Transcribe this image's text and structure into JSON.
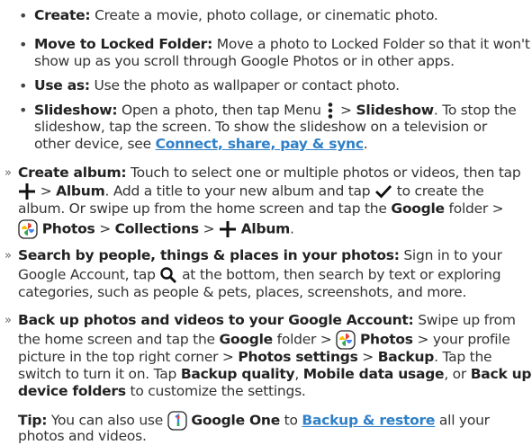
{
  "items": {
    "create": {
      "label": "Create:",
      "text": "Create a movie, photo collage, or cinematic photo."
    },
    "locked": {
      "label": "Move to Locked Folder:",
      "line1": "Move a photo to Locked Folder so that it won't",
      "line2": "show up as you scroll through Google Photos or in other apps."
    },
    "useas": {
      "label": "Use as:",
      "text": "Use the photo as wallpaper or contact photo."
    },
    "slideshow": {
      "label": "Slideshow:",
      "pre": "Open a photo, then tap Menu",
      "sep": ">",
      "target": "Slideshow",
      "post": ". To stop the",
      "line2": "slideshow, tap the screen. To show the slideshow on a television or",
      "line3": "other device, see",
      "link": "Connect, share, pay & sync",
      "end": "."
    }
  },
  "sections": {
    "album": {
      "label": "Create album:",
      "line1": "Touch to select one or multiple photos or videos, then tap",
      "sep": ">",
      "album": "Album",
      "mid": ". Add a title to your new album and tap",
      "mid2": "to create the",
      "line3": "album. Or swipe up from the home screen and tap the",
      "google": "Google",
      "folder": "folder >",
      "photos": "Photos",
      "collections": "Collections",
      "album2": "Album",
      "end": "."
    },
    "search": {
      "label": "Search by people, things & places in your photos:",
      "pre": "Sign in to your",
      "line2a": "Google Account, tap",
      "line2b": "at the bottom, then search by text or exploring",
      "line3": "categories, such as people & pets, places, screenshots, and more."
    },
    "backup": {
      "label": "Back up photos and videos to your Google Account:",
      "pre": "Swipe up from",
      "line2a": "the home screen and tap the",
      "google": "Google",
      "line2b": "folder >",
      "photos": "Photos",
      "line2c": "> your profile",
      "line3a": "picture in the top right corner >",
      "settings": "Photos settings",
      "sep": ">",
      "backup": "Backup",
      "line3b": ". Tap the",
      "line4a": "switch to turn it on. Tap",
      "quality": "Backup quality",
      "comma": ",",
      "mobile": "Mobile data usage",
      "or": ", or",
      "backfolders": "Back up",
      "line5a": "device folders",
      "line5b": "to customize the settings."
    },
    "tip": {
      "label": "Tip:",
      "pre": "You can also use",
      "one": "Google One",
      "to": "to",
      "link": "Backup & restore",
      "post": "all your",
      "line2": "photos and videos."
    }
  },
  "markers": {
    "bullet": "•",
    "section": "»"
  },
  "colors": {
    "text": "#333333",
    "link": "#2f80c8"
  }
}
